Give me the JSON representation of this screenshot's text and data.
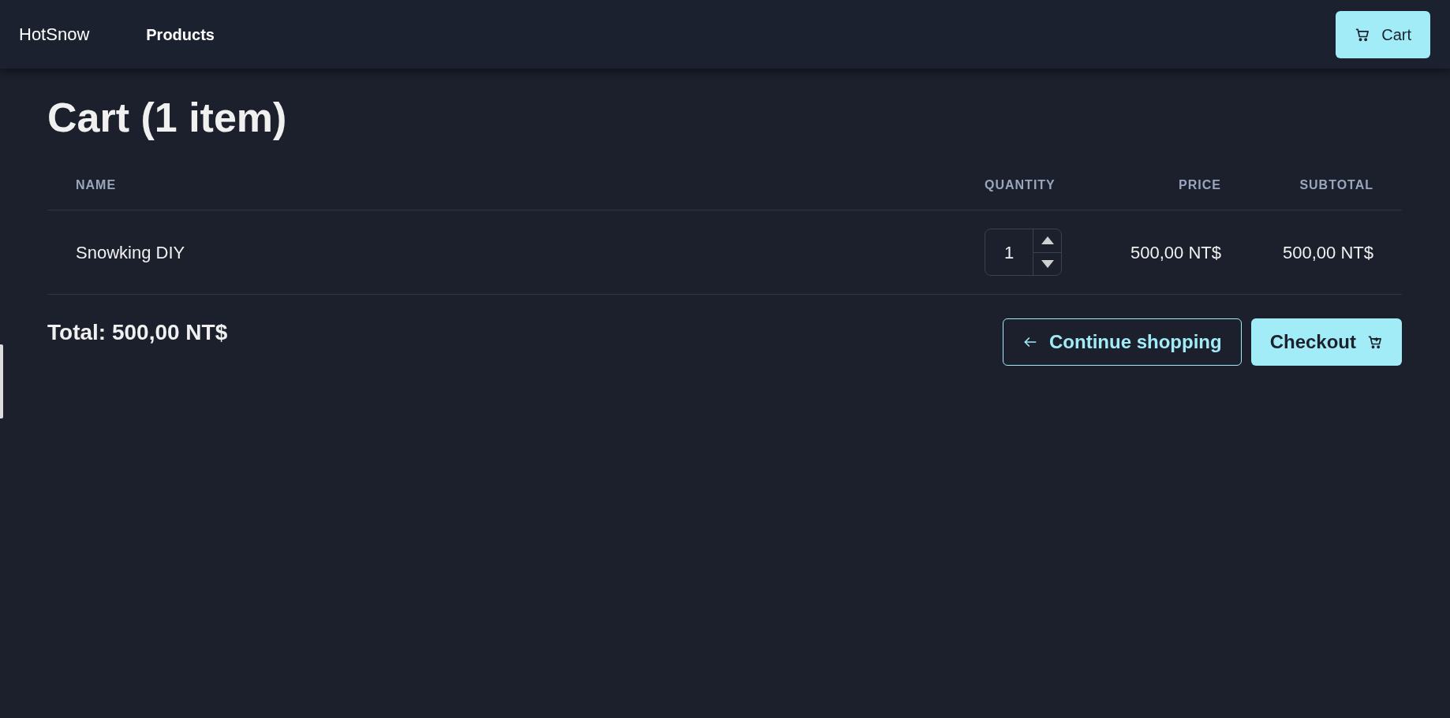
{
  "navbar": {
    "brand": "HotSnow",
    "links": [
      {
        "label": "Products"
      }
    ],
    "cart_button": "Cart"
  },
  "page": {
    "title": "Cart (1 item)"
  },
  "table": {
    "columns": [
      "NAME",
      "QUANTITY",
      "PRICE",
      "SUBTOTAL"
    ],
    "rows": [
      {
        "name": "Snowking DIY",
        "quantity": "1",
        "price": "500,00 NT$",
        "subtotal": "500,00 NT$"
      }
    ]
  },
  "total": "Total: 500,00 NT$",
  "buttons": {
    "continue": "Continue shopping",
    "checkout": "Checkout"
  }
}
